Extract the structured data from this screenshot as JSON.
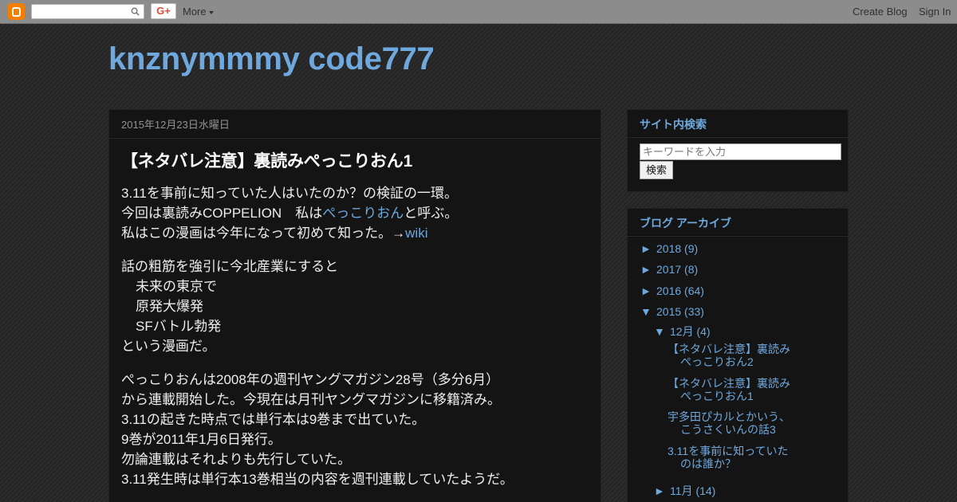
{
  "navbar": {
    "gplus_label": "G+",
    "more_label": "More",
    "create_blog_label": "Create Blog",
    "sign_in_label": "Sign In"
  },
  "blog": {
    "title": "knznymmmy code777"
  },
  "post": {
    "date": "2015年12月23日水曜日",
    "title": "【ネタバレ注意】裏読みぺっこりおん1",
    "paragraphs": [
      {
        "lines": [
          "3.11を事前に知っていた人はいたのか？の検証の一環。",
          "今回は裏読みCOPPELION　私は",
          "私はこの漫画は今年になって初めて知った。→"
        ],
        "link_pekkorion": "ぺっこりおん",
        "line2_suffix": "と呼ぶ。",
        "link_wiki": "wiki"
      },
      {
        "lines": [
          "話の粗筋を強引に今北産業にすると",
          "未来の東京で",
          "原発大爆発",
          "SFバトル勃発",
          "という漫画だ。"
        ]
      },
      {
        "lines": [
          "ぺっこりおんは2008年の週刊ヤングマガジン28号（多分6月）",
          "から連載開始した。今現在は月刊ヤングマガジンに移籍済み。",
          "3.11の起きた時点では単行本は9巻まで出ていた。",
          "9巻が2011年1月6日発行。",
          "勿論連載はそれよりも先行していた。",
          "3.11発生時は単行本13巻相当の内容を週刊連載していたようだ。"
        ]
      }
    ]
  },
  "sidebar": {
    "search": {
      "title": "サイト内検索",
      "placeholder": "キーワードを入力",
      "button_label": "検索"
    },
    "archive": {
      "title": "ブログ アーカイブ",
      "collapsed_glyph": "►",
      "expanded_glyph": "▼",
      "years": [
        {
          "label": "2018",
          "count": "(9)"
        },
        {
          "label": "2017",
          "count": "(8)"
        },
        {
          "label": "2016",
          "count": "(64)"
        },
        {
          "label": "2015",
          "count": "(33)"
        }
      ],
      "month_expanded": {
        "label": "12月",
        "count": "(4)"
      },
      "posts": [
        "【ネタバレ注意】裏読みぺっこりおん2",
        "【ネタバレ注意】裏読みぺっこりおん1",
        "宇多田ぴカルとかいう、こうさくいんの話3",
        "3.11を事前に知っていたのは誰か？"
      ],
      "month_collapsed": {
        "label": "11月",
        "count": "(14)"
      }
    }
  },
  "colors": {
    "accent": "#6fa8dc",
    "navbar": "#8c8c8c",
    "panel": "#141414",
    "blogger_orange": "#f57d00"
  }
}
